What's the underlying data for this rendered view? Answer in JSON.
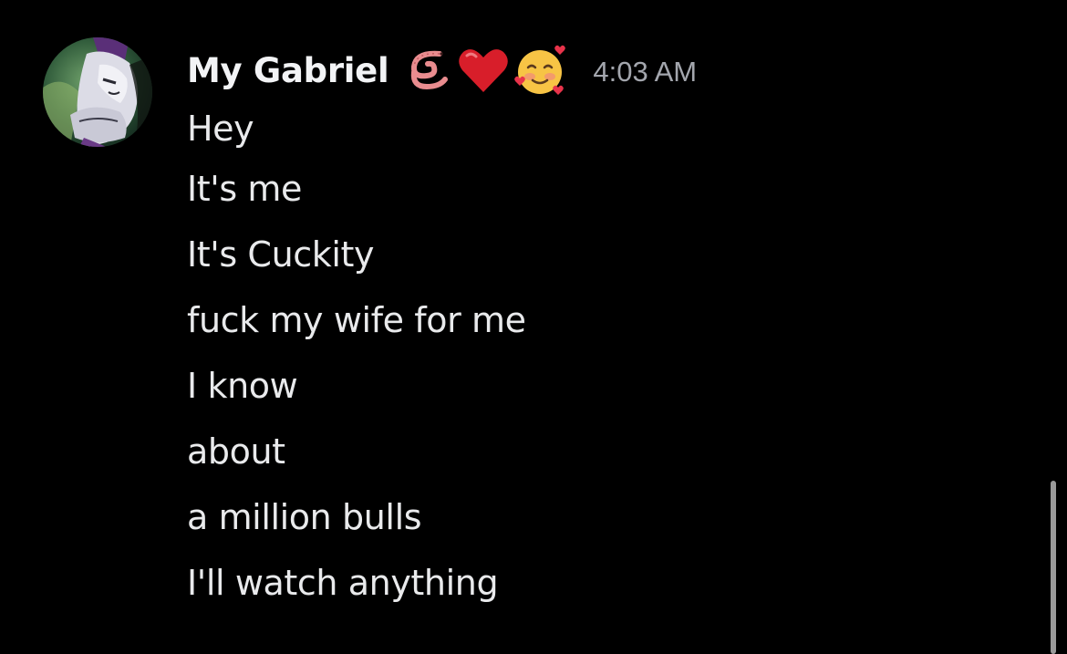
{
  "message_group": {
    "author": {
      "display_name": "My Gabriel",
      "avatar_icon": "anime-character-avatar",
      "badges": [
        {
          "icon": "worm-emoji",
          "glyph": "🪱"
        },
        {
          "icon": "red-heart-emoji",
          "glyph": "❤️"
        },
        {
          "icon": "smiling-face-with-hearts-emoji",
          "glyph": "🥰"
        }
      ]
    },
    "timestamp": "4:03 AM",
    "messages": [
      "Hey",
      "It's me",
      "It's Cuckity",
      "fuck my wife for me",
      "I know",
      "about",
      "a million bulls",
      "I'll watch anything"
    ]
  },
  "colors": {
    "background": "#000000",
    "username": "#f2f3f5",
    "timestamp": "#a3a6ad",
    "message_text": "#e9eaec",
    "scrollbar": "#9a9a9a"
  }
}
